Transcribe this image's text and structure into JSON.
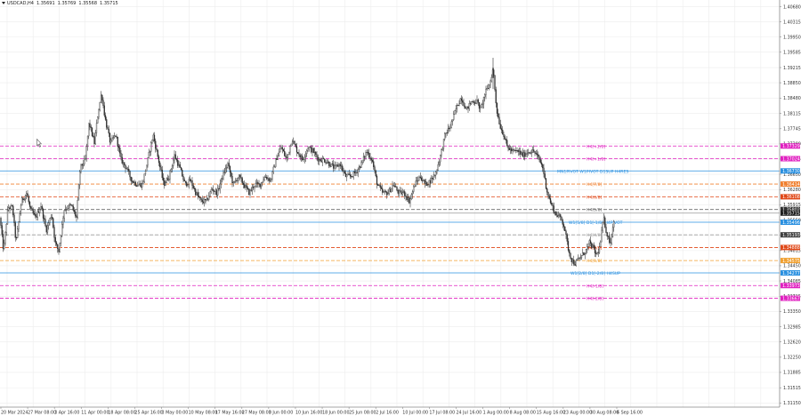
{
  "header": {
    "symbol": "USDCAD,H4",
    "open": "1.35691",
    "high": "1.35769",
    "low": "1.35568",
    "close": "1.35715"
  },
  "colors": {
    "background": "#ffffff",
    "grid": "#ececec",
    "candle": "#2b2b2b",
    "axis_text": "#333333"
  },
  "chart_data": {
    "type": "candlestick",
    "symbol": "USDCAD",
    "timeframe": "H4",
    "x_ticks": [
      "20 Mar 2024",
      "27 Mar 08:00",
      "3 Apr 16:00",
      "11 Apr 00:00",
      "18 Apr 08:00",
      "25 Apr 16:00",
      "3 May 00:00",
      "10 May 08:00",
      "17 May 16:00",
      "27 May 08:00",
      "3 Jun 00:00",
      "10 Jun 16:00",
      "18 Jun 00:00",
      "25 Jun 08:00",
      "2 Jul 16:00",
      "10 Jul 00:00",
      "17 Jul 08:00",
      "24 Jul 16:00",
      "1 Aug 00:00",
      "8 Aug 08:00",
      "15 Aug 16:00",
      "23 Aug 00:00",
      "30 Aug 08:00",
      "6 Sep 16:00"
    ],
    "y_ticks": [
      "1.40680",
      "1.40315",
      "1.39950",
      "1.39585",
      "1.39215",
      "1.38850",
      "1.38480",
      "1.38115",
      "1.37745",
      "1.37380",
      "1.37015",
      "1.36650",
      "1.36280",
      "1.35915",
      "1.35550",
      "1.35185",
      "1.34815",
      "1.34450",
      "1.34085",
      "1.33715",
      "1.33350",
      "1.32985",
      "1.32620",
      "1.32250",
      "1.31885",
      "1.31515",
      "1.31150"
    ],
    "ylim": [
      1.3105,
      1.4084
    ],
    "price_path": [
      [
        0,
        1.356
      ],
      [
        4,
        1.348
      ],
      [
        9,
        1.3585
      ],
      [
        14,
        1.3585
      ],
      [
        18,
        1.35
      ],
      [
        24,
        1.36
      ],
      [
        30,
        1.362
      ],
      [
        34,
        1.358
      ],
      [
        40,
        1.356
      ],
      [
        46,
        1.359
      ],
      [
        52,
        1.353
      ],
      [
        58,
        1.357
      ],
      [
        62,
        1.35
      ],
      [
        66,
        1.348
      ],
      [
        72,
        1.358
      ],
      [
        80,
        1.359
      ],
      [
        86,
        1.356
      ],
      [
        90,
        1.368
      ],
      [
        96,
        1.37
      ],
      [
        100,
        1.379
      ],
      [
        106,
        1.374
      ],
      [
        110,
        1.381
      ],
      [
        114,
        1.386
      ],
      [
        118,
        1.38
      ],
      [
        124,
        1.374
      ],
      [
        130,
        1.376
      ],
      [
        136,
        1.37
      ],
      [
        142,
        1.368
      ],
      [
        148,
        1.365
      ],
      [
        154,
        1.364
      ],
      [
        160,
        1.364
      ],
      [
        166,
        1.37
      ],
      [
        172,
        1.376
      ],
      [
        178,
        1.37
      ],
      [
        184,
        1.364
      ],
      [
        190,
        1.366
      ],
      [
        196,
        1.371
      ],
      [
        202,
        1.368
      ],
      [
        208,
        1.364
      ],
      [
        214,
        1.365
      ],
      [
        220,
        1.362
      ],
      [
        226,
        1.36
      ],
      [
        232,
        1.36
      ],
      [
        238,
        1.363
      ],
      [
        244,
        1.362
      ],
      [
        250,
        1.366
      ],
      [
        256,
        1.369
      ],
      [
        262,
        1.364
      ],
      [
        268,
        1.366
      ],
      [
        274,
        1.364
      ],
      [
        280,
        1.362
      ],
      [
        286,
        1.364
      ],
      [
        292,
        1.364
      ],
      [
        298,
        1.366
      ],
      [
        304,
        1.365
      ],
      [
        310,
        1.37
      ],
      [
        316,
        1.373
      ],
      [
        322,
        1.37
      ],
      [
        328,
        1.375
      ],
      [
        334,
        1.372
      ],
      [
        340,
        1.37
      ],
      [
        346,
        1.373
      ],
      [
        352,
        1.372
      ],
      [
        358,
        1.37
      ],
      [
        364,
        1.37
      ],
      [
        370,
        1.369
      ],
      [
        376,
        1.368
      ],
      [
        382,
        1.369
      ],
      [
        388,
        1.366
      ],
      [
        394,
        1.366
      ],
      [
        400,
        1.367
      ],
      [
        406,
        1.369
      ],
      [
        412,
        1.372
      ],
      [
        418,
        1.37
      ],
      [
        424,
        1.364
      ],
      [
        430,
        1.362
      ],
      [
        436,
        1.362
      ],
      [
        442,
        1.364
      ],
      [
        448,
        1.362
      ],
      [
        454,
        1.362
      ],
      [
        460,
        1.36
      ],
      [
        466,
        1.364
      ],
      [
        472,
        1.366
      ],
      [
        478,
        1.364
      ],
      [
        484,
        1.365
      ],
      [
        490,
        1.367
      ],
      [
        496,
        1.372
      ],
      [
        500,
        1.376
      ],
      [
        506,
        1.378
      ],
      [
        512,
        1.382
      ],
      [
        518,
        1.385
      ],
      [
        524,
        1.382
      ],
      [
        530,
        1.384
      ],
      [
        536,
        1.384
      ],
      [
        540,
        1.382
      ],
      [
        545,
        1.386
      ],
      [
        550,
        1.388
      ],
      [
        554,
        1.392
      ],
      [
        558,
        1.382
      ],
      [
        562,
        1.378
      ],
      [
        566,
        1.376
      ],
      [
        570,
        1.373
      ],
      [
        576,
        1.372
      ],
      [
        582,
        1.372
      ],
      [
        588,
        1.371
      ],
      [
        594,
        1.372
      ],
      [
        600,
        1.372
      ],
      [
        606,
        1.37
      ],
      [
        610,
        1.368
      ],
      [
        614,
        1.363
      ],
      [
        618,
        1.36
      ],
      [
        624,
        1.357
      ],
      [
        630,
        1.356
      ],
      [
        634,
        1.354
      ],
      [
        638,
        1.349
      ],
      [
        642,
        1.346
      ],
      [
        646,
        1.345
      ],
      [
        650,
        1.346
      ],
      [
        654,
        1.347
      ],
      [
        658,
        1.348
      ],
      [
        662,
        1.35
      ],
      [
        666,
        1.349
      ],
      [
        670,
        1.347
      ],
      [
        674,
        1.349
      ],
      [
        678,
        1.356
      ],
      [
        682,
        1.352
      ],
      [
        686,
        1.35
      ],
      [
        690,
        1.356
      ]
    ],
    "levels": [
      {
        "label": "H4[+2/8]",
        "price": 1.37329,
        "color": "#e020c0",
        "dash": true,
        "box": "1.37329",
        "label_x": 659
      },
      {
        "label": "H4[+1/8]",
        "price": 1.37024,
        "color": "#e020c0",
        "dash": true,
        "box": "1.37024",
        "label_x": 659
      },
      {
        "label": "MN1PIVOT W1PIVOT D1SUP H4RES",
        "price": 1.3673,
        "color": "#2a90e0",
        "dash": false,
        "box": "1.36730",
        "label_x": 626
      },
      {
        "label": "H4[7/8]",
        "price": 1.36414,
        "color": "#f08030",
        "dash": true,
        "box": "1.36414",
        "label_x": 659
      },
      {
        "label": "H4[6/8]",
        "price": 1.36108,
        "color": "#e04818",
        "dash": true,
        "box": "1.36108",
        "label_x": 659
      },
      {
        "label": "H4[5/8]",
        "price": 1.35802,
        "color": "#6a6a6a",
        "dash": true,
        "box": "1.35802",
        "label_x": 659,
        "box_color": "#303030"
      },
      {
        "label": "",
        "price": 1.35715,
        "color": "#9a9a9a",
        "dash": false,
        "box": "1.35715",
        "label_x": 0,
        "box_color": "#202020"
      },
      {
        "label": "W1[5/8] D1[-1/8] H4PIVOT",
        "price": 1.35496,
        "color": "#2a90e0",
        "dash": false,
        "box": "1.35496",
        "label_x": 639
      },
      {
        "label": "H4[4/8]",
        "price": 1.35193,
        "color": "#a0a0a0",
        "dash": true,
        "box": "1.35193",
        "label_x": 659,
        "box_color": "#404040"
      },
      {
        "label": "H4[3/8]",
        "price": 1.34888,
        "color": "#e04818",
        "dash": true,
        "box": "1.34888",
        "label_x": 659
      },
      {
        "label": "H4[1/8]",
        "price": 1.34575,
        "color": "#f0a030",
        "dash": true,
        "box": "1.34575",
        "label_x": 659
      },
      {
        "label": "W1[2/8] D1[-2/8] H4SUP",
        "price": 1.34277,
        "color": "#2a90e0",
        "dash": false,
        "box": "1.34277",
        "label_x": 641
      },
      {
        "label": "H4[-1/8]",
        "price": 1.33973,
        "color": "#e020c0",
        "dash": true,
        "box": "1.33973",
        "label_x": 659
      },
      {
        "label": "H4[-2/8]",
        "price": 1.33667,
        "color": "#e020c0",
        "dash": true,
        "box": "1.33667",
        "label_x": 659
      }
    ]
  }
}
